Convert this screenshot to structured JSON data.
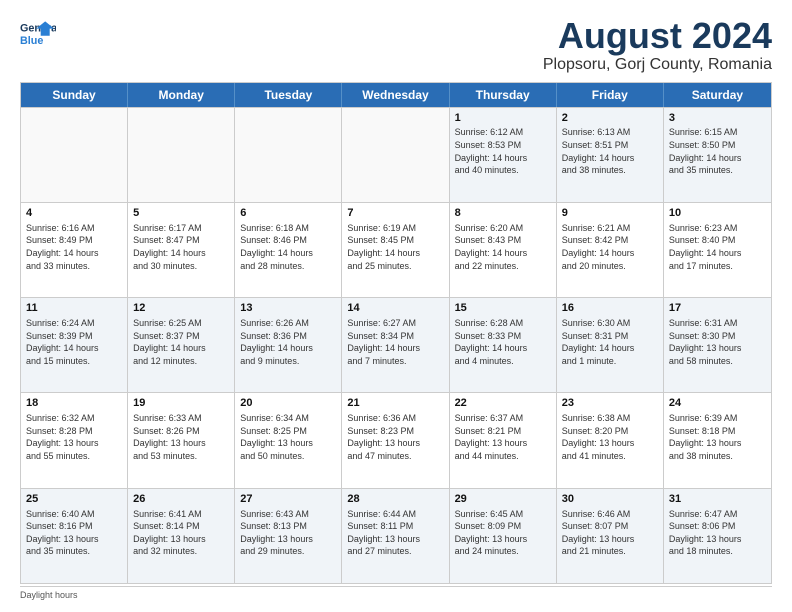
{
  "header": {
    "logo_line1": "General",
    "logo_line2": "Blue",
    "title": "August 2024",
    "subtitle": "Plopsoru, Gorj County, Romania"
  },
  "days_of_week": [
    "Sunday",
    "Monday",
    "Tuesday",
    "Wednesday",
    "Thursday",
    "Friday",
    "Saturday"
  ],
  "weeks": [
    [
      {
        "day": "",
        "info": ""
      },
      {
        "day": "",
        "info": ""
      },
      {
        "day": "",
        "info": ""
      },
      {
        "day": "",
        "info": ""
      },
      {
        "day": "1",
        "info": "Sunrise: 6:12 AM\nSunset: 8:53 PM\nDaylight: 14 hours\nand 40 minutes."
      },
      {
        "day": "2",
        "info": "Sunrise: 6:13 AM\nSunset: 8:51 PM\nDaylight: 14 hours\nand 38 minutes."
      },
      {
        "day": "3",
        "info": "Sunrise: 6:15 AM\nSunset: 8:50 PM\nDaylight: 14 hours\nand 35 minutes."
      }
    ],
    [
      {
        "day": "4",
        "info": "Sunrise: 6:16 AM\nSunset: 8:49 PM\nDaylight: 14 hours\nand 33 minutes."
      },
      {
        "day": "5",
        "info": "Sunrise: 6:17 AM\nSunset: 8:47 PM\nDaylight: 14 hours\nand 30 minutes."
      },
      {
        "day": "6",
        "info": "Sunrise: 6:18 AM\nSunset: 8:46 PM\nDaylight: 14 hours\nand 28 minutes."
      },
      {
        "day": "7",
        "info": "Sunrise: 6:19 AM\nSunset: 8:45 PM\nDaylight: 14 hours\nand 25 minutes."
      },
      {
        "day": "8",
        "info": "Sunrise: 6:20 AM\nSunset: 8:43 PM\nDaylight: 14 hours\nand 22 minutes."
      },
      {
        "day": "9",
        "info": "Sunrise: 6:21 AM\nSunset: 8:42 PM\nDaylight: 14 hours\nand 20 minutes."
      },
      {
        "day": "10",
        "info": "Sunrise: 6:23 AM\nSunset: 8:40 PM\nDaylight: 14 hours\nand 17 minutes."
      }
    ],
    [
      {
        "day": "11",
        "info": "Sunrise: 6:24 AM\nSunset: 8:39 PM\nDaylight: 14 hours\nand 15 minutes."
      },
      {
        "day": "12",
        "info": "Sunrise: 6:25 AM\nSunset: 8:37 PM\nDaylight: 14 hours\nand 12 minutes."
      },
      {
        "day": "13",
        "info": "Sunrise: 6:26 AM\nSunset: 8:36 PM\nDaylight: 14 hours\nand 9 minutes."
      },
      {
        "day": "14",
        "info": "Sunrise: 6:27 AM\nSunset: 8:34 PM\nDaylight: 14 hours\nand 7 minutes."
      },
      {
        "day": "15",
        "info": "Sunrise: 6:28 AM\nSunset: 8:33 PM\nDaylight: 14 hours\nand 4 minutes."
      },
      {
        "day": "16",
        "info": "Sunrise: 6:30 AM\nSunset: 8:31 PM\nDaylight: 14 hours\nand 1 minute."
      },
      {
        "day": "17",
        "info": "Sunrise: 6:31 AM\nSunset: 8:30 PM\nDaylight: 13 hours\nand 58 minutes."
      }
    ],
    [
      {
        "day": "18",
        "info": "Sunrise: 6:32 AM\nSunset: 8:28 PM\nDaylight: 13 hours\nand 55 minutes."
      },
      {
        "day": "19",
        "info": "Sunrise: 6:33 AM\nSunset: 8:26 PM\nDaylight: 13 hours\nand 53 minutes."
      },
      {
        "day": "20",
        "info": "Sunrise: 6:34 AM\nSunset: 8:25 PM\nDaylight: 13 hours\nand 50 minutes."
      },
      {
        "day": "21",
        "info": "Sunrise: 6:36 AM\nSunset: 8:23 PM\nDaylight: 13 hours\nand 47 minutes."
      },
      {
        "day": "22",
        "info": "Sunrise: 6:37 AM\nSunset: 8:21 PM\nDaylight: 13 hours\nand 44 minutes."
      },
      {
        "day": "23",
        "info": "Sunrise: 6:38 AM\nSunset: 8:20 PM\nDaylight: 13 hours\nand 41 minutes."
      },
      {
        "day": "24",
        "info": "Sunrise: 6:39 AM\nSunset: 8:18 PM\nDaylight: 13 hours\nand 38 minutes."
      }
    ],
    [
      {
        "day": "25",
        "info": "Sunrise: 6:40 AM\nSunset: 8:16 PM\nDaylight: 13 hours\nand 35 minutes."
      },
      {
        "day": "26",
        "info": "Sunrise: 6:41 AM\nSunset: 8:14 PM\nDaylight: 13 hours\nand 32 minutes."
      },
      {
        "day": "27",
        "info": "Sunrise: 6:43 AM\nSunset: 8:13 PM\nDaylight: 13 hours\nand 29 minutes."
      },
      {
        "day": "28",
        "info": "Sunrise: 6:44 AM\nSunset: 8:11 PM\nDaylight: 13 hours\nand 27 minutes."
      },
      {
        "day": "29",
        "info": "Sunrise: 6:45 AM\nSunset: 8:09 PM\nDaylight: 13 hours\nand 24 minutes."
      },
      {
        "day": "30",
        "info": "Sunrise: 6:46 AM\nSunset: 8:07 PM\nDaylight: 13 hours\nand 21 minutes."
      },
      {
        "day": "31",
        "info": "Sunrise: 6:47 AM\nSunset: 8:06 PM\nDaylight: 13 hours\nand 18 minutes."
      }
    ]
  ],
  "footer": "Daylight hours"
}
